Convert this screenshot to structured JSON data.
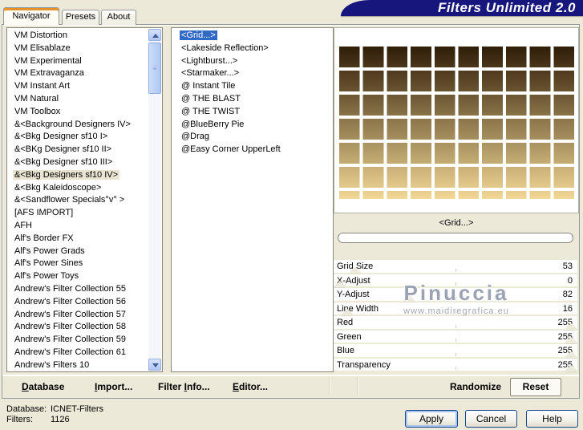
{
  "window": {
    "title": "Filters Unlimited 2.0"
  },
  "tabs": [
    {
      "label": "Navigator",
      "active": true
    },
    {
      "label": "Presets",
      "active": false
    },
    {
      "label": "About",
      "active": false
    }
  ],
  "navigator_list": {
    "selected_index": 11,
    "items": [
      "VM Distortion",
      "VM Elisablaze",
      "VM Experimental",
      "VM Extravaganza",
      "VM Instant Art",
      "VM Natural",
      "VM Toolbox",
      "&<Background Designers IV>",
      "&<Bkg Designer sf10 I>",
      "&<BKg Designer sf10 II>",
      "&<Bkg Designer sf10 III>",
      "&<Bkg Designers sf10 IV>",
      "&<Bkg Kaleidoscope>",
      "&<Sandflower Specials°v° >",
      "[AFS IMPORT]",
      "AFH",
      "Alf's Border FX",
      "Alf's Power Grads",
      "Alf's Power Sines",
      "Alf's Power Toys",
      "Andrew's Filter Collection 55",
      "Andrew's Filter Collection 56",
      "Andrew's Filter Collection 57",
      "Andrew's Filter Collection 58",
      "Andrew's Filter Collection 59",
      "Andrew's Filter Collection 61",
      "Andrew's Filters 10"
    ]
  },
  "filter_list": {
    "selected_index": 0,
    "items": [
      "<Grid...>",
      "<Lakeside Reflection>",
      "<Lightburst...>",
      "<Starmaker...>",
      "@ Instant Tile",
      "@ THE BLAST",
      "@ THE TWIST",
      "@BlueBerry Pie",
      "@Drag",
      "@Easy Corner UpperLeft"
    ]
  },
  "preview": {
    "caption": "<Grid...>",
    "progress_pct": 0
  },
  "sliders": [
    {
      "label": "Grid Size",
      "value": "53",
      "thumb_pct": 9
    },
    {
      "label": "X-Adjust",
      "value": "0",
      "thumb_pct": 2.5
    },
    {
      "label": "Y-Adjust",
      "value": "82",
      "thumb_pct": 31
    },
    {
      "label": "Line Width",
      "value": "16",
      "thumb_pct": 5.5
    },
    {
      "label": "Red",
      "value": "255",
      "thumb_pct": 97.5
    },
    {
      "label": "Green",
      "value": "255",
      "thumb_pct": 97.5
    },
    {
      "label": "Blue",
      "value": "255",
      "thumb_pct": 97.5
    },
    {
      "label": "Transparency",
      "value": "255",
      "thumb_pct": 97.5
    }
  ],
  "watermark": {
    "line1": "Pinuccia",
    "line2": "www.maidiregrafica.eu"
  },
  "toolbar": {
    "items": [
      {
        "label": "Database",
        "underline_index": 0
      },
      {
        "label": "Import...",
        "underline_index": 0
      },
      {
        "label": "Filter Info...",
        "underline_index": 7
      },
      {
        "label": "Editor...",
        "underline_index": 0
      },
      {
        "label": "Randomize",
        "underline_index": -1
      }
    ],
    "reset_label": "Reset"
  },
  "status": {
    "database_label": "Database:",
    "database_value": "ICNET-Filters",
    "filters_label": "Filters:",
    "filters_value": "1126"
  },
  "buttons": {
    "apply": "Apply",
    "cancel": "Cancel",
    "help": "Help"
  },
  "colors": {
    "banner": "#16167d",
    "selection": "#316ac5",
    "background": "#ece9d8",
    "tab_accent": "#e5912d",
    "grid_top": "#2f1d07",
    "grid_bottom": "#f2d795"
  }
}
